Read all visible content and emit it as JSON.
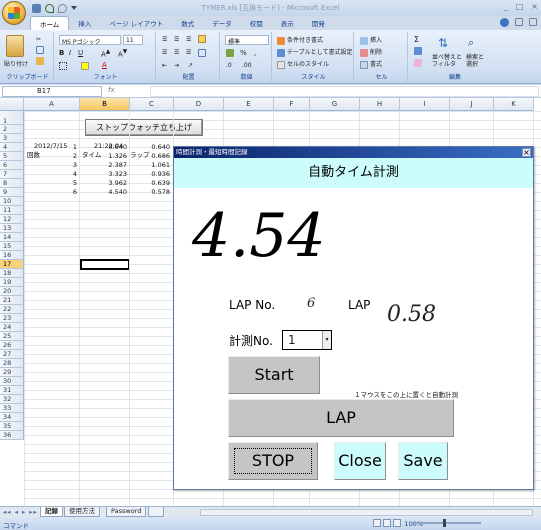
{
  "window": {
    "title": "TYMER.xls [互換モード] - Microsoft Excel",
    "controls": [
      "_",
      "□",
      "×"
    ]
  },
  "ribbon": {
    "tabs": [
      "ホーム",
      "挿入",
      "ページ レイアウト",
      "数式",
      "データ",
      "校閲",
      "表示",
      "開発"
    ],
    "groups": {
      "clipboard": {
        "label": "クリップボード",
        "paste": "貼り付け"
      },
      "font": {
        "label": "フォント",
        "name": "MS Pゴシック",
        "size": "11"
      },
      "alignment": {
        "label": "配置"
      },
      "number": {
        "label": "数値",
        "format": "標準",
        "percent": "%",
        "comma": ","
      },
      "styles": {
        "label": "スタイル",
        "items": [
          "条件付き書式",
          "テーブルとして書式設定",
          "セルのスタイル"
        ]
      },
      "cells": {
        "label": "セル",
        "items": [
          "挿入",
          "削除",
          "書式"
        ]
      },
      "editing": {
        "label": "編集",
        "sort": "並べ替えと\nフィルタ",
        "find": "検索と\n選択"
      }
    }
  },
  "formula_bar": {
    "name_box": "B17",
    "fx": "fx",
    "value": ""
  },
  "sheet": {
    "columns": [
      "A",
      "B",
      "C",
      "D",
      "E",
      "F",
      "G",
      "H",
      "I",
      "J",
      "K"
    ],
    "selected_column": "B",
    "rows": [
      "1",
      "2",
      "3",
      "4",
      "5",
      "6",
      "7",
      "8",
      "9",
      "10",
      "11",
      "12",
      "13",
      "14",
      "15",
      "16",
      "17",
      "18",
      "19",
      "20",
      "21",
      "22",
      "23",
      "24",
      "25",
      "26",
      "27",
      "28",
      "29",
      "30",
      "31",
      "32",
      "33",
      "34",
      "35",
      "36"
    ],
    "selected_row": "17",
    "button_label": "ストップウォッチ立ち上げ",
    "cells": {
      "a2": "2012/7/15",
      "b2": "21:22:04",
      "a3": "回数",
      "b3": "タイム",
      "c3": "ラップ"
    },
    "laps": [
      {
        "n": "1",
        "time": "0.640",
        "lap": "0.640"
      },
      {
        "n": "2",
        "time": "1.326",
        "lap": "0.686"
      },
      {
        "n": "3",
        "time": "2.387",
        "lap": "1.061"
      },
      {
        "n": "4",
        "time": "3.323",
        "lap": "0.936"
      },
      {
        "n": "5",
        "time": "3.962",
        "lap": "0.639"
      },
      {
        "n": "6",
        "time": "4.540",
        "lap": "0.578"
      }
    ],
    "tabs": [
      "記録",
      "使用方法",
      "Password"
    ],
    "active_tab": "記録"
  },
  "status": {
    "ready": "コマンド",
    "zoom": "100%"
  },
  "form": {
    "title": "時間計測・最短時間記録",
    "close": "×",
    "banner": "自動タイム計測",
    "elapsed": "4.54",
    "lap_no_label": "LAP No.",
    "lap_no_value": "6",
    "lap_label": "LAP",
    "lap_value": "0.58",
    "measure_label": "計測No.",
    "measure_value": "1",
    "start_button": "Start",
    "hint": "１マウスをこの上に置くと自動計測",
    "lap_button": "LAP",
    "stop_button": "STOP",
    "close_button": "Close",
    "save_button": "Save"
  }
}
